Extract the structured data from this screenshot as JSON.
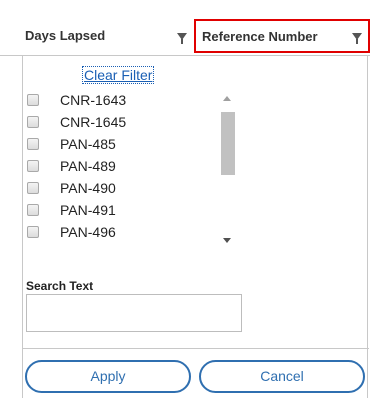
{
  "grid_header": {
    "columns": [
      {
        "label": "Days Lapsed",
        "icon": "filter-icon"
      },
      {
        "label": "Reference Number",
        "icon": "filter-icon"
      }
    ],
    "highlight_color": "#e00000"
  },
  "filter_popup": {
    "clear_filter_label": "Clear Filter",
    "items": [
      {
        "label": "CNR-1643",
        "checked": false
      },
      {
        "label": "CNR-1645",
        "checked": false
      },
      {
        "label": "PAN-485",
        "checked": false
      },
      {
        "label": "PAN-489",
        "checked": false
      },
      {
        "label": "PAN-490",
        "checked": false
      },
      {
        "label": "PAN-491",
        "checked": false
      },
      {
        "label": "PAN-496",
        "checked": false
      }
    ],
    "search_label": "Search Text",
    "search_value": "",
    "search_placeholder": "",
    "apply_label": "Apply",
    "cancel_label": "Cancel",
    "accent_color": "#2f6fb0",
    "link_color": "#1a5fb4"
  }
}
